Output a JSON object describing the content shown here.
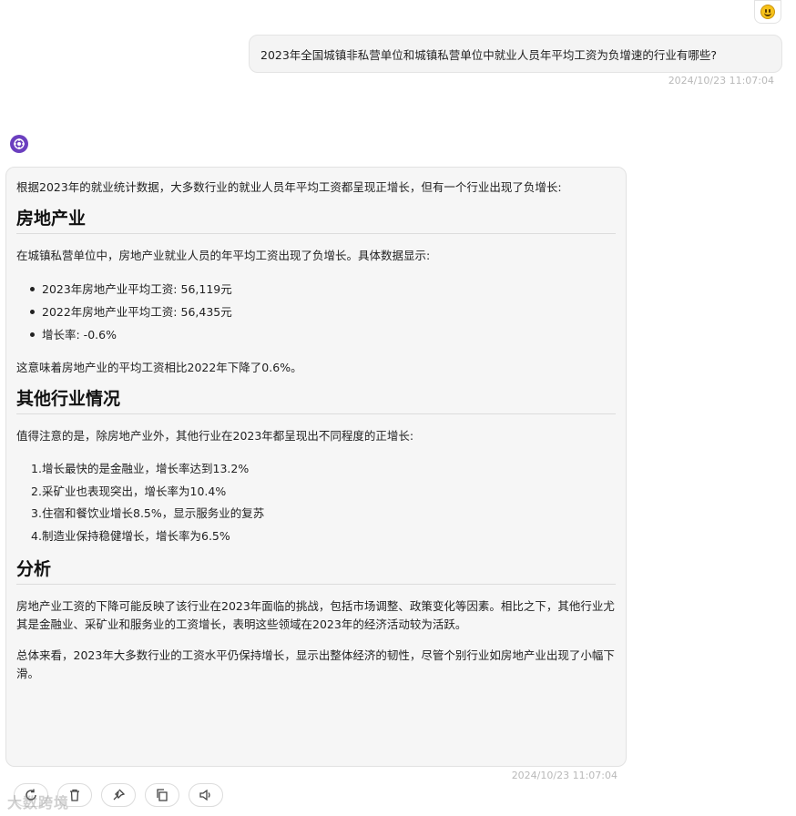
{
  "user": {
    "avatar_icon": "smiley-emoji-icon",
    "question": "2023年全国城镇非私营单位和城镇私营单位中就业人员年平均工资为负增速的行业有哪些?",
    "timestamp": "2024/10/23 11:07:04"
  },
  "bot": {
    "avatar_icon": "ai-assistant-icon",
    "intro": "根据2023年的就业统计数据，大多数行业的就业人员年平均工资都呈现正增长，但有一个行业出现了负增长:",
    "section1": {
      "heading": "房地产业",
      "text": "在城镇私营单位中，房地产业就业人员的年平均工资出现了负增长。具体数据显示:",
      "bullets": [
        "2023年房地产业平均工资: 56,119元",
        "2022年房地产业平均工资: 56,435元",
        "增长率: -0.6%"
      ],
      "conclusion": "这意味着房地产业的平均工资相比2022年下降了0.6%。"
    },
    "section2": {
      "heading": "其他行业情况",
      "text": "值得注意的是，除房地产业外，其他行业在2023年都呈现出不同程度的正增长:",
      "items": [
        {
          "num": "1.",
          "text": "增长最快的是金融业，增长率达到13.2%"
        },
        {
          "num": "2.",
          "text": "采矿业也表现突出，增长率为10.4%"
        },
        {
          "num": "3.",
          "text": "住宿和餐饮业增长8.5%，显示服务业的复苏"
        },
        {
          "num": "4.",
          "text": "制造业保持稳健增长，增长率为6.5%"
        }
      ]
    },
    "section3": {
      "heading": "分析",
      "para1": "房地产业工资的下降可能反映了该行业在2023年面临的挑战，包括市场调整、政策变化等因素。相比之下，其他行业尤其是金融业、采矿业和服务业的工资增长，表明这些领域在2023年的经济活动较为活跃。",
      "para2": "总体来看，2023年大多数行业的工资水平仍保持增长，显示出整体经济的韧性，尽管个别行业如房地产业出现了小幅下滑。"
    },
    "timestamp": "2024/10/23 11:07:04"
  },
  "actions": [
    "regenerate-icon",
    "delete-icon",
    "pin-icon",
    "copy-icon",
    "speaker-icon"
  ],
  "watermark": "大数跨境",
  "colors": {
    "bot_avatar": "#6b3fbf",
    "bubble_bg": "#f6f6f6",
    "timestamp": "#b9b9b9"
  }
}
